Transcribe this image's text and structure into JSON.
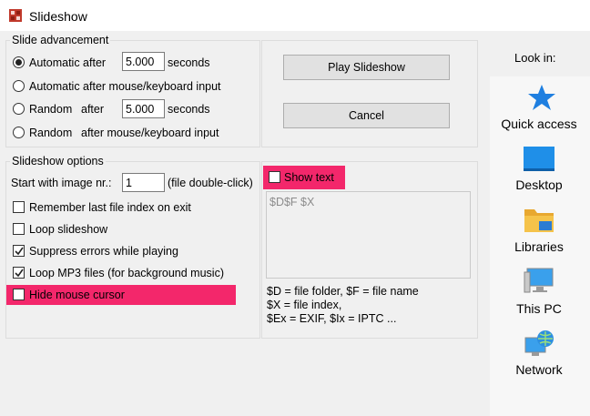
{
  "window": {
    "title": "Slideshow",
    "icon": "puzzle-app-icon"
  },
  "slide_advancement": {
    "legend": "Slide advancement",
    "automatic_after_label": "Automatic after",
    "automatic_after_value": "5.000",
    "automatic_after_unit": "seconds",
    "automatic_input_label": "Automatic after mouse/keyboard input",
    "random_label": "Random",
    "random_after_label": "after",
    "random_after_value": "5.000",
    "random_after_unit": "seconds",
    "random_input_label": "Random",
    "random_input_suffix": "after mouse/keyboard input",
    "selected": "automatic_after"
  },
  "buttons": {
    "play": "Play Slideshow",
    "cancel": "Cancel"
  },
  "slideshow_options": {
    "legend": "Slideshow options",
    "start_label": "Start with image nr.:",
    "start_value": "1",
    "start_hint": "(file double-click)",
    "remember_last": {
      "label": "Remember last file index on exit",
      "checked": false
    },
    "loop": {
      "label": "Loop slideshow",
      "checked": false
    },
    "suppress_errors": {
      "label": "Suppress errors while playing",
      "checked": true
    },
    "loop_mp3": {
      "label": "Loop MP3 files (for background music)",
      "checked": true
    },
    "hide_cursor": {
      "label": "Hide mouse cursor",
      "checked": false
    }
  },
  "show_text": {
    "label": "Show text",
    "checked": false,
    "placeholder": "$D$F $X",
    "help_line1": "$D = file folder, $F = file name",
    "help_line2": "$X = file index,",
    "help_line3": "$Ex = EXIF, $Ix = IPTC ..."
  },
  "highlight_color": "#f3276b",
  "side_panel": {
    "look_in": "Look in:",
    "items": [
      {
        "label": "Quick access",
        "icon": "star-icon"
      },
      {
        "label": "Desktop",
        "icon": "desktop-icon"
      },
      {
        "label": "Libraries",
        "icon": "folder-icon"
      },
      {
        "label": "This PC",
        "icon": "computer-icon"
      },
      {
        "label": "Network",
        "icon": "network-icon"
      }
    ]
  }
}
